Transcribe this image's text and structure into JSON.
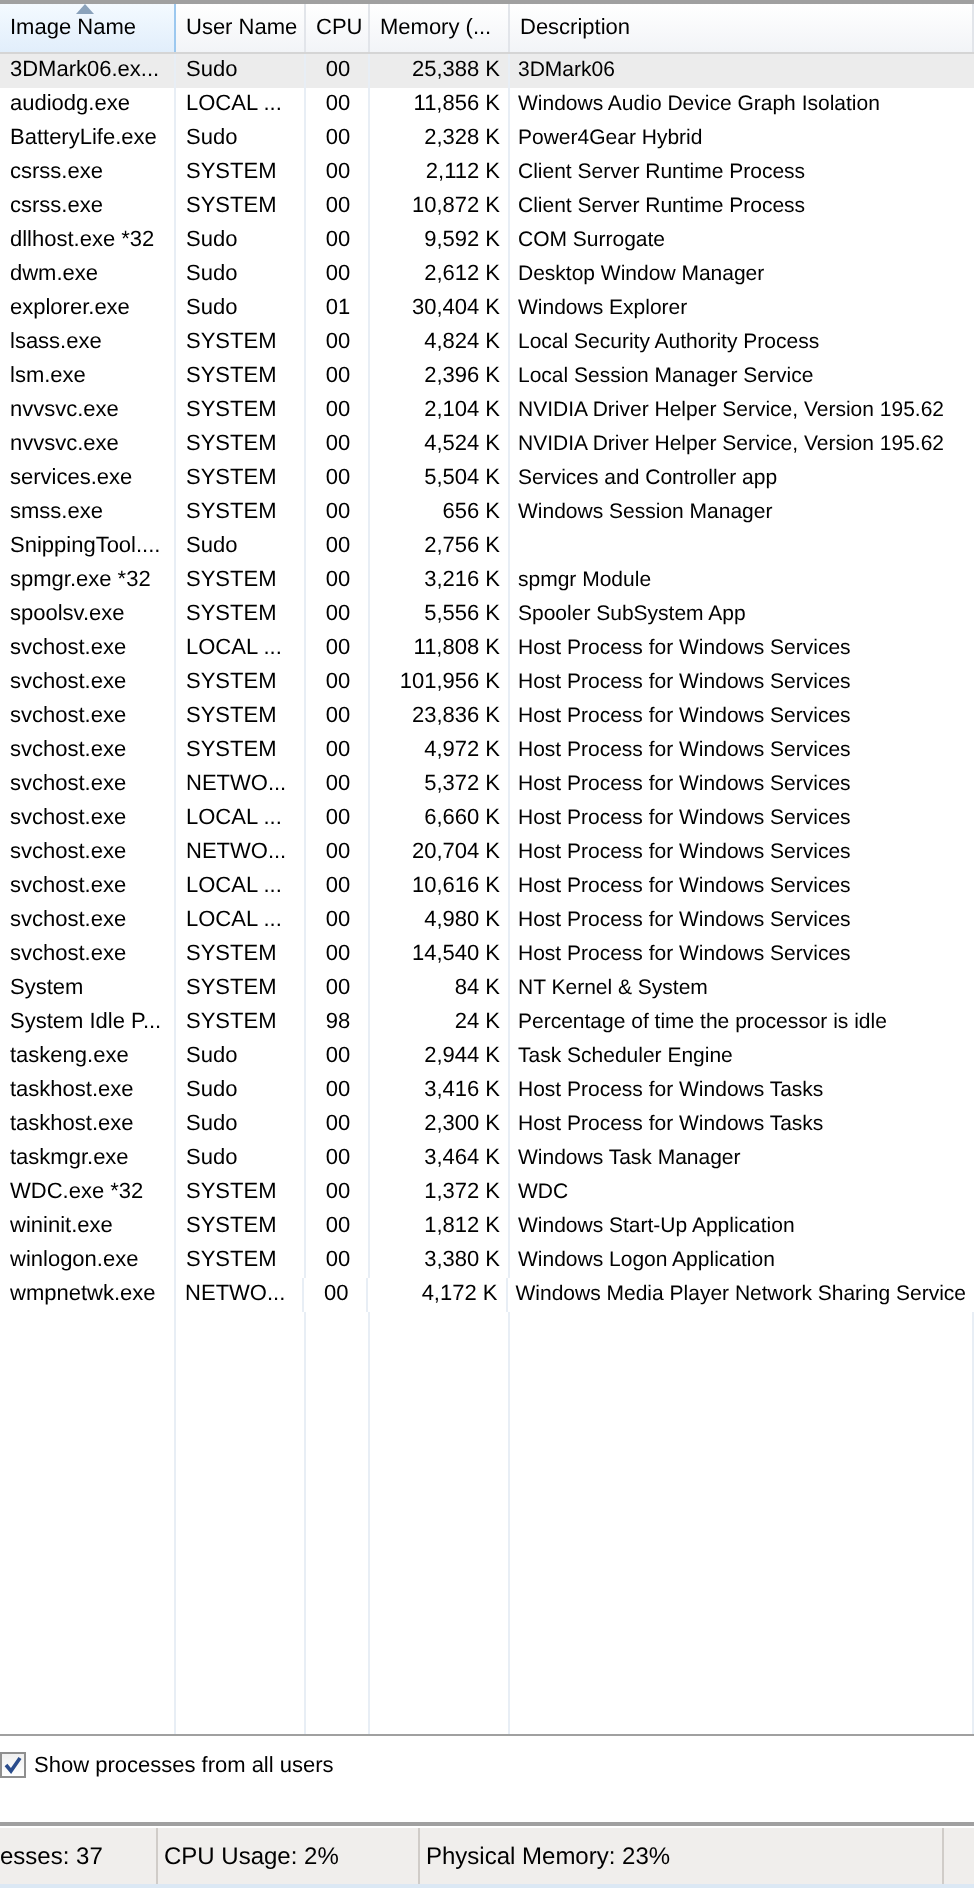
{
  "table": {
    "columns": [
      {
        "label": "Image Name",
        "sorted": true
      },
      {
        "label": "User Name",
        "sorted": false
      },
      {
        "label": "CPU",
        "sorted": false
      },
      {
        "label": "Memory (...",
        "sorted": false
      },
      {
        "label": "Description",
        "sorted": false
      }
    ],
    "rows": [
      {
        "name": "3DMark06.ex...",
        "user": "Sudo",
        "cpu": "00",
        "memory": "25,388 K",
        "description": "3DMark06",
        "selected": true
      },
      {
        "name": "audiodg.exe",
        "user": "LOCAL ...",
        "cpu": "00",
        "memory": "11,856 K",
        "description": "Windows Audio Device Graph Isolation",
        "selected": false
      },
      {
        "name": "BatteryLife.exe",
        "user": "Sudo",
        "cpu": "00",
        "memory": "2,328 K",
        "description": "Power4Gear Hybrid",
        "selected": false
      },
      {
        "name": "csrss.exe",
        "user": "SYSTEM",
        "cpu": "00",
        "memory": "2,112 K",
        "description": "Client Server Runtime Process",
        "selected": false
      },
      {
        "name": "csrss.exe",
        "user": "SYSTEM",
        "cpu": "00",
        "memory": "10,872 K",
        "description": "Client Server Runtime Process",
        "selected": false
      },
      {
        "name": "dllhost.exe *32",
        "user": "Sudo",
        "cpu": "00",
        "memory": "9,592 K",
        "description": "COM Surrogate",
        "selected": false
      },
      {
        "name": "dwm.exe",
        "user": "Sudo",
        "cpu": "00",
        "memory": "2,612 K",
        "description": "Desktop Window Manager",
        "selected": false
      },
      {
        "name": "explorer.exe",
        "user": "Sudo",
        "cpu": "01",
        "memory": "30,404 K",
        "description": "Windows Explorer",
        "selected": false
      },
      {
        "name": "lsass.exe",
        "user": "SYSTEM",
        "cpu": "00",
        "memory": "4,824 K",
        "description": "Local Security Authority Process",
        "selected": false
      },
      {
        "name": "lsm.exe",
        "user": "SYSTEM",
        "cpu": "00",
        "memory": "2,396 K",
        "description": "Local Session Manager Service",
        "selected": false
      },
      {
        "name": "nvvsvc.exe",
        "user": "SYSTEM",
        "cpu": "00",
        "memory": "2,104 K",
        "description": "NVIDIA Driver Helper Service, Version 195.62",
        "selected": false
      },
      {
        "name": "nvvsvc.exe",
        "user": "SYSTEM",
        "cpu": "00",
        "memory": "4,524 K",
        "description": "NVIDIA Driver Helper Service, Version 195.62",
        "selected": false
      },
      {
        "name": "services.exe",
        "user": "SYSTEM",
        "cpu": "00",
        "memory": "5,504 K",
        "description": "Services and Controller app",
        "selected": false
      },
      {
        "name": "smss.exe",
        "user": "SYSTEM",
        "cpu": "00",
        "memory": "656 K",
        "description": "Windows Session Manager",
        "selected": false
      },
      {
        "name": "SnippingTool....",
        "user": "Sudo",
        "cpu": "00",
        "memory": "2,756 K",
        "selected": false
      },
      {
        "name": "spmgr.exe *32",
        "user": "SYSTEM",
        "cpu": "00",
        "memory": "3,216 K",
        "description": "spmgr Module",
        "selected": false
      },
      {
        "name": "spoolsv.exe",
        "user": "SYSTEM",
        "cpu": "00",
        "memory": "5,556 K",
        "description": "Spooler SubSystem App",
        "selected": false
      },
      {
        "name": "svchost.exe",
        "user": "LOCAL ...",
        "cpu": "00",
        "memory": "11,808 K",
        "description": "Host Process for Windows Services",
        "selected": false
      },
      {
        "name": "svchost.exe",
        "user": "SYSTEM",
        "cpu": "00",
        "memory": "101,956 K",
        "description": "Host Process for Windows Services",
        "selected": false
      },
      {
        "name": "svchost.exe",
        "user": "SYSTEM",
        "cpu": "00",
        "memory": "23,836 K",
        "description": "Host Process for Windows Services",
        "selected": false
      },
      {
        "name": "svchost.exe",
        "user": "SYSTEM",
        "cpu": "00",
        "memory": "4,972 K",
        "description": "Host Process for Windows Services",
        "selected": false
      },
      {
        "name": "svchost.exe",
        "user": "NETWO...",
        "cpu": "00",
        "memory": "5,372 K",
        "description": "Host Process for Windows Services",
        "selected": false
      },
      {
        "name": "svchost.exe",
        "user": "LOCAL ...",
        "cpu": "00",
        "memory": "6,660 K",
        "description": "Host Process for Windows Services",
        "selected": false
      },
      {
        "name": "svchost.exe",
        "user": "NETWO...",
        "cpu": "00",
        "memory": "20,704 K",
        "description": "Host Process for Windows Services",
        "selected": false
      },
      {
        "name": "svchost.exe",
        "user": "LOCAL ...",
        "cpu": "00",
        "memory": "10,616 K",
        "description": "Host Process for Windows Services",
        "selected": false
      },
      {
        "name": "svchost.exe",
        "user": "LOCAL ...",
        "cpu": "00",
        "memory": "4,980 K",
        "description": "Host Process for Windows Services",
        "selected": false
      },
      {
        "name": "svchost.exe",
        "user": "SYSTEM",
        "cpu": "00",
        "memory": "14,540 K",
        "description": "Host Process for Windows Services",
        "selected": false
      },
      {
        "name": "System",
        "user": "SYSTEM",
        "cpu": "00",
        "memory": "84 K",
        "description": "NT Kernel & System",
        "selected": false
      },
      {
        "name": "System Idle P...",
        "user": "SYSTEM",
        "cpu": "98",
        "memory": "24 K",
        "description": "Percentage of time the processor is idle",
        "selected": false
      },
      {
        "name": "taskeng.exe",
        "user": "Sudo",
        "cpu": "00",
        "memory": "2,944 K",
        "description": "Task Scheduler Engine",
        "selected": false
      },
      {
        "name": "taskhost.exe",
        "user": "Sudo",
        "cpu": "00",
        "memory": "3,416 K",
        "description": "Host Process for Windows Tasks",
        "selected": false
      },
      {
        "name": "taskhost.exe",
        "user": "Sudo",
        "cpu": "00",
        "memory": "2,300 K",
        "description": "Host Process for Windows Tasks",
        "selected": false
      },
      {
        "name": "taskmgr.exe",
        "user": "Sudo",
        "cpu": "00",
        "memory": "3,464 K",
        "description": "Windows Task Manager",
        "selected": false
      },
      {
        "name": "WDC.exe *32",
        "user": "SYSTEM",
        "cpu": "00",
        "memory": "1,372 K",
        "description": "WDC",
        "selected": false
      },
      {
        "name": "wininit.exe",
        "user": "SYSTEM",
        "cpu": "00",
        "memory": "1,812 K",
        "description": "Windows Start-Up Application",
        "selected": false
      },
      {
        "name": "winlogon.exe",
        "user": "SYSTEM",
        "cpu": "00",
        "memory": "3,380 K",
        "description": "Windows Logon Application",
        "selected": false
      },
      {
        "name": "wmpnetwk.exe",
        "user": "NETWO...",
        "cpu": "00",
        "memory": "4,172 K",
        "description": "Windows Media Player Network Sharing Service",
        "selected": false
      }
    ]
  },
  "show_all_users": {
    "label": "Show processes from all users",
    "checked": true
  },
  "status_bar": [
    "esses: 37",
    "CPU Usage: 2%",
    "Physical Memory: 23%"
  ]
}
